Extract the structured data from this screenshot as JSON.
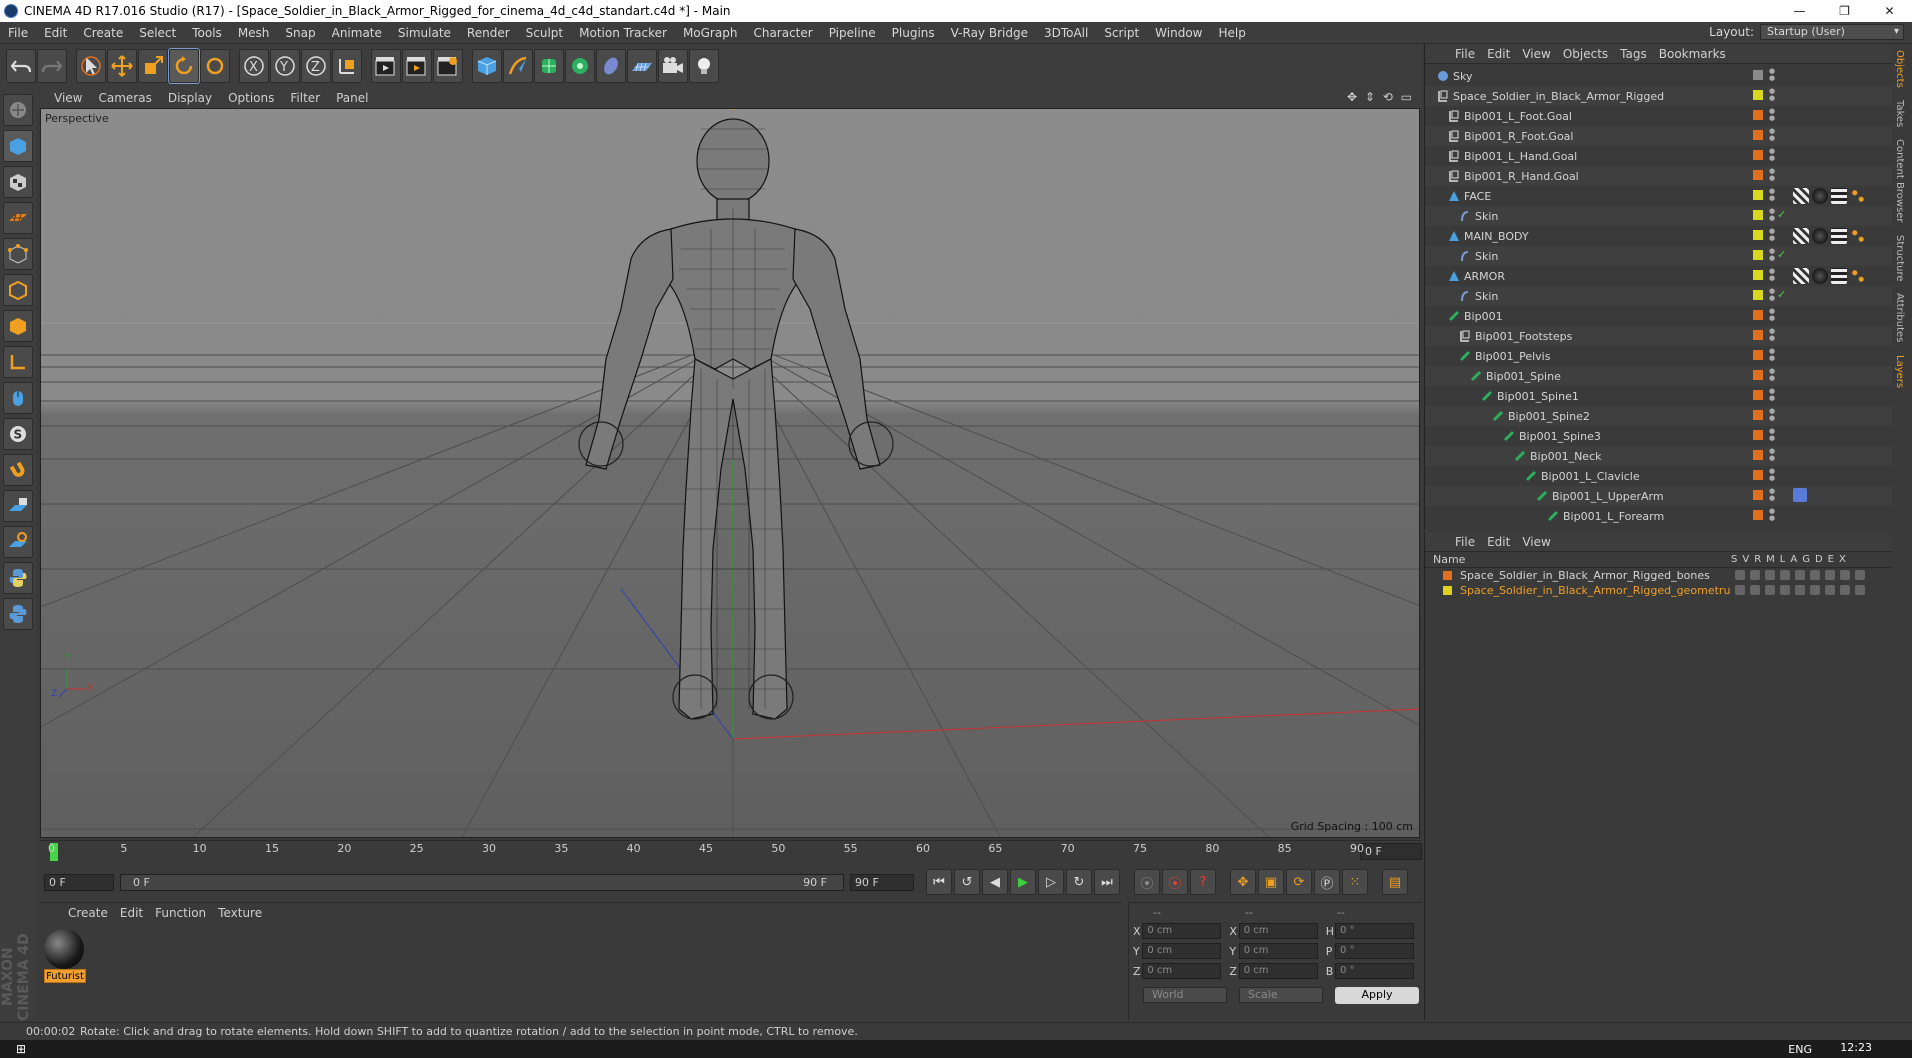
{
  "window": {
    "title": "CINEMA 4D R17.016 Studio (R17) - [Space_Soldier_in_Black_Armor_Rigged_for_cinema_4d_c4d_standart.c4d *] - Main",
    "minimize": "—",
    "maximize": "❐",
    "close": "✕"
  },
  "menubar": {
    "items": [
      "File",
      "Edit",
      "Create",
      "Select",
      "Tools",
      "Mesh",
      "Snap",
      "Animate",
      "Simulate",
      "Render",
      "Sculpt",
      "Motion Tracker",
      "MoGraph",
      "Character",
      "Pipeline",
      "Plugins",
      "V-Ray Bridge",
      "3DToAll",
      "Script",
      "Window",
      "Help"
    ],
    "layout_label": "Layout:",
    "layout_value": "Startup (User)"
  },
  "viewport": {
    "menu": [
      "View",
      "Cameras",
      "Display",
      "Options",
      "Filter",
      "Panel"
    ],
    "label": "Perspective",
    "grid_spacing": "Grid Spacing : 100 cm",
    "axis_y": "Y",
    "axis_x": "X",
    "axis_z": "Z"
  },
  "timeline": {
    "ticks": [
      "0",
      "5",
      "10",
      "15",
      "20",
      "25",
      "30",
      "35",
      "40",
      "45",
      "50",
      "55",
      "60",
      "65",
      "70",
      "75",
      "80",
      "85",
      "90"
    ],
    "current_frame": "0 F"
  },
  "transport": {
    "start": "0 F",
    "range_start": "0 F",
    "range_end": "90 F",
    "end": "90 F"
  },
  "material_panel": {
    "menu": [
      "Create",
      "Edit",
      "Function",
      "Texture"
    ],
    "material_name": "Futurist"
  },
  "coordinates": {
    "headers": [
      "--",
      "--",
      "--"
    ],
    "rows": [
      {
        "a": "X",
        "v1": "0 cm",
        "b": "X",
        "v2": "0 cm",
        "c": "H",
        "v3": "0 °"
      },
      {
        "a": "Y",
        "v1": "0 cm",
        "b": "Y",
        "v2": "0 cm",
        "c": "P",
        "v3": "0 °"
      },
      {
        "a": "Z",
        "v1": "0 cm",
        "b": "Z",
        "v2": "0 cm",
        "c": "B",
        "v3": "0 °"
      }
    ],
    "mode": "World",
    "scale": "Scale",
    "apply": "Apply"
  },
  "object_manager": {
    "menu": [
      "File",
      "Edit",
      "View",
      "Objects",
      "Tags",
      "Bookmarks"
    ],
    "objects": [
      {
        "name": "Sky",
        "indent": 0,
        "tag": "#8a8a8a",
        "icon": "sky"
      },
      {
        "name": "Space_Soldier_in_Black_Armor_Rigged",
        "indent": 0,
        "tag": "#d8d820",
        "icon": "null"
      },
      {
        "name": "Bip001_L_Foot.Goal",
        "indent": 1,
        "tag": "#e07020",
        "icon": "null"
      },
      {
        "name": "Bip001_R_Foot.Goal",
        "indent": 1,
        "tag": "#e07020",
        "icon": "null"
      },
      {
        "name": "Bip001_L_Hand.Goal",
        "indent": 1,
        "tag": "#e07020",
        "icon": "null"
      },
      {
        "name": "Bip001_R_Hand.Goal",
        "indent": 1,
        "tag": "#e07020",
        "icon": "null"
      },
      {
        "name": "FACE",
        "indent": 1,
        "tag": "#d8d820",
        "icon": "poly",
        "tags": true
      },
      {
        "name": "Skin",
        "indent": 2,
        "tag": "#d8d820",
        "icon": "skin",
        "check": true
      },
      {
        "name": "MAIN_BODY",
        "indent": 1,
        "tag": "#d8d820",
        "icon": "poly",
        "tags": true
      },
      {
        "name": "Skin",
        "indent": 2,
        "tag": "#d8d820",
        "icon": "skin",
        "check": true
      },
      {
        "name": "ARMOR",
        "indent": 1,
        "tag": "#d8d820",
        "icon": "poly",
        "tags": true
      },
      {
        "name": "Skin",
        "indent": 2,
        "tag": "#d8d820",
        "icon": "skin",
        "check": true
      },
      {
        "name": "Bip001",
        "indent": 1,
        "tag": "#e07020",
        "icon": "bone"
      },
      {
        "name": "Bip001_Footsteps",
        "indent": 2,
        "tag": "#e07020",
        "icon": "null"
      },
      {
        "name": "Bip001_Pelvis",
        "indent": 2,
        "tag": "#e07020",
        "icon": "bone"
      },
      {
        "name": "Bip001_Spine",
        "indent": 3,
        "tag": "#e07020",
        "icon": "bone"
      },
      {
        "name": "Bip001_Spine1",
        "indent": 4,
        "tag": "#e07020",
        "icon": "bone"
      },
      {
        "name": "Bip001_Spine2",
        "indent": 5,
        "tag": "#e07020",
        "icon": "bone"
      },
      {
        "name": "Bip001_Spine3",
        "indent": 6,
        "tag": "#e07020",
        "icon": "bone"
      },
      {
        "name": "Bip001_Neck",
        "indent": 7,
        "tag": "#e07020",
        "icon": "bone"
      },
      {
        "name": "Bip001_L_Clavicle",
        "indent": 8,
        "tag": "#e07020",
        "icon": "bone"
      },
      {
        "name": "Bip001_L_UpperArm",
        "indent": 9,
        "tag": "#e07020",
        "icon": "bone",
        "ik": true
      },
      {
        "name": "Bip001_L_Forearm",
        "indent": 10,
        "tag": "#e07020",
        "icon": "bone"
      }
    ]
  },
  "layer_manager": {
    "menu": [
      "File",
      "Edit",
      "View"
    ],
    "name_header": "Name",
    "columns": [
      "S",
      "V",
      "R",
      "M",
      "L",
      "A",
      "G",
      "D",
      "E",
      "X"
    ],
    "layers": [
      {
        "name": "Space_Soldier_in_Black_Armor_Rigged_bones",
        "color": "#e07020",
        "active": false
      },
      {
        "name": "Space_Soldier_in_Black_Armor_Rigged_geometru",
        "color": "#e0d020",
        "active": true
      }
    ]
  },
  "side_tabs": [
    "Objects",
    "Takes",
    "Content Browser",
    "Structure",
    "Attributes",
    "Layers"
  ],
  "branding": "MAXON CINEMA 4D",
  "statusbar": {
    "time": "00:00:02",
    "message": "Rotate: Click and drag to rotate elements. Hold down SHIFT to add to quantize rotation / add to the selection in point mode, CTRL to remove."
  },
  "taskbar": {
    "lang": "ENG",
    "clock": "12:23"
  }
}
